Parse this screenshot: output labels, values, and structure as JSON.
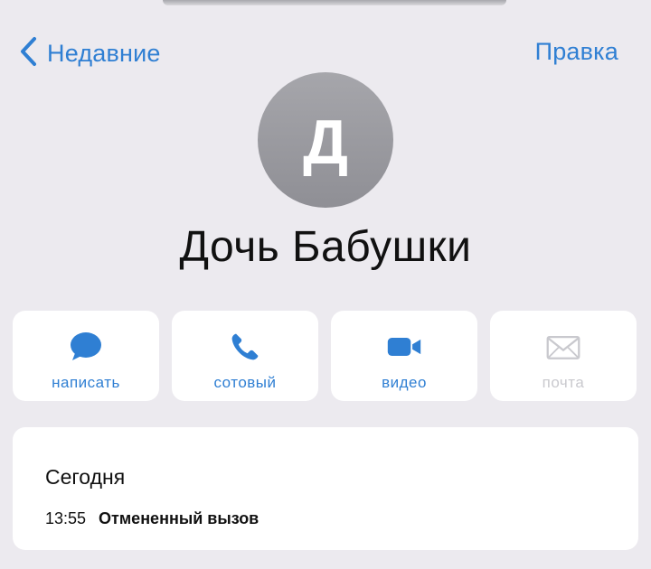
{
  "nav": {
    "back_label": "Недавние",
    "edit_label": "Правка"
  },
  "contact": {
    "initial": "Д",
    "name": "Дочь Бабушки"
  },
  "actions": [
    {
      "label": "написать",
      "icon": "message-bubble-icon",
      "enabled": true
    },
    {
      "label": "сотовый",
      "icon": "phone-icon",
      "enabled": true
    },
    {
      "label": "видео",
      "icon": "video-camera-icon",
      "enabled": true
    },
    {
      "label": "почта",
      "icon": "envelope-icon",
      "enabled": false
    }
  ],
  "recent": {
    "day": "Сегодня",
    "time": "13:55",
    "status": "Отмененный вызов"
  },
  "colors": {
    "accent": "#2f7fd3",
    "background": "#eceaef",
    "card": "#ffffff",
    "avatar": "#9b9ba0",
    "disabled": "#c9c9ce"
  }
}
